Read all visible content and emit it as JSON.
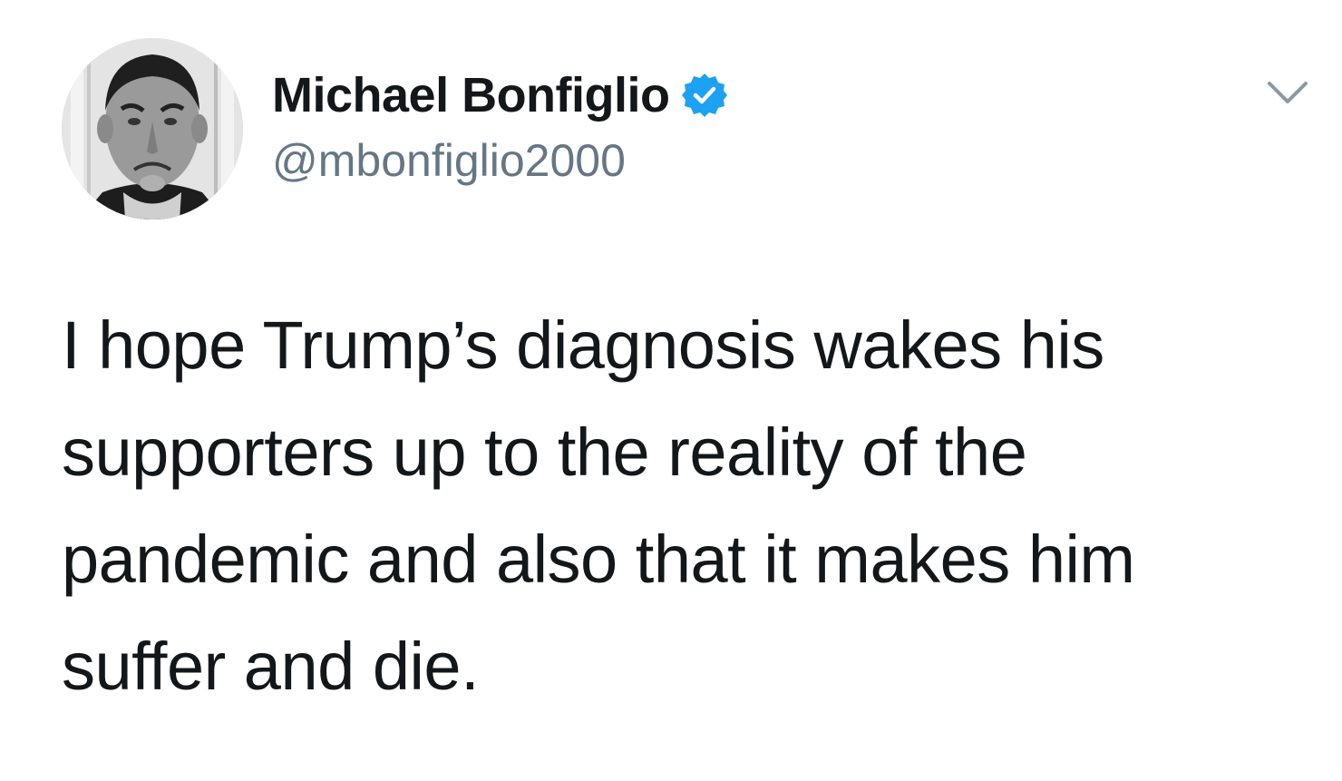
{
  "author": {
    "display_name": "Michael Bonfiglio",
    "handle": "@mbonfiglio2000",
    "verified": true,
    "avatar_icon": "profile-photo-icon",
    "verified_icon": "verified-badge-icon"
  },
  "tweet": {
    "text": "I hope Trump’s diagnosis wakes his supporters up to the reality of the pandemic and also that it makes him suffer and die."
  },
  "menu": {
    "icon": "chevron-down-icon"
  },
  "colors": {
    "verified_blue": "#1da1f2",
    "text_primary": "#14171a",
    "text_secondary": "#657786",
    "caret": "#8899a6"
  }
}
